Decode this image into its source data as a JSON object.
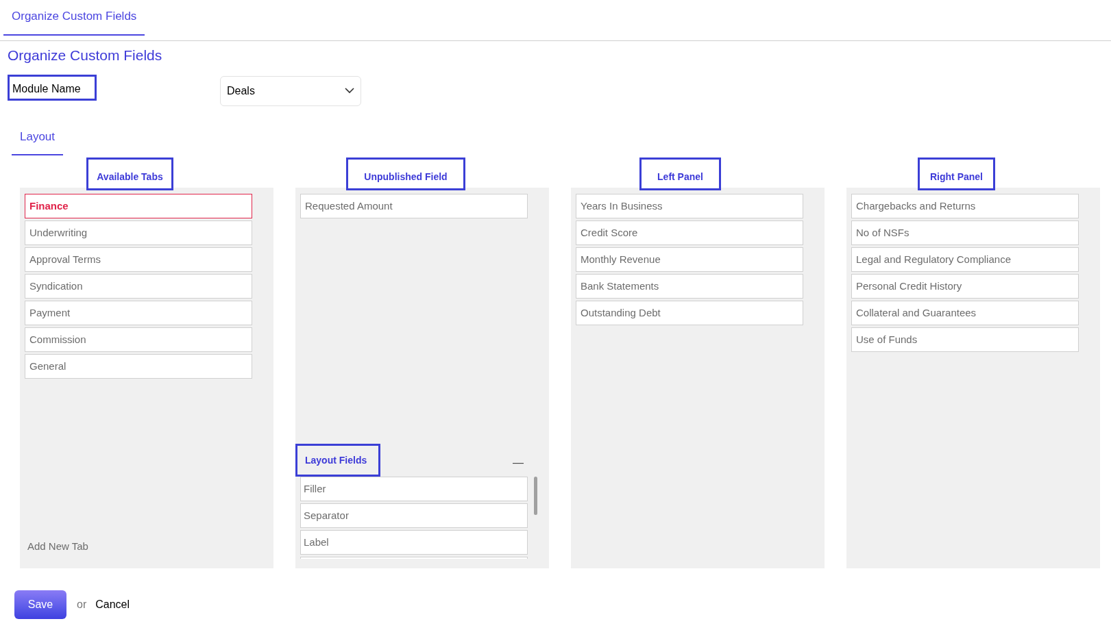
{
  "top_tabs": [
    {
      "label": "Organize Custom Fields",
      "selected": true
    }
  ],
  "title": "Organize Custom Fields",
  "module": {
    "label": "Module Name",
    "value": "Deals"
  },
  "section_tabs": [
    {
      "label": "Layout",
      "selected": true
    }
  ],
  "columns": [
    {
      "heading": "Available Tabs",
      "items": [
        {
          "label": "Finance",
          "selected": true
        },
        {
          "label": "Underwriting",
          "selected": false
        },
        {
          "label": "Approval Terms",
          "selected": false
        },
        {
          "label": "Syndication",
          "selected": false
        },
        {
          "label": "Payment",
          "selected": false
        },
        {
          "label": "Commission",
          "selected": false
        },
        {
          "label": "General",
          "selected": false
        }
      ],
      "footer_link": "Add New Tab"
    },
    {
      "heading": "Unpublished Field",
      "items": [
        {
          "label": "Requested Amount",
          "selected": false
        }
      ],
      "layout_fields": {
        "heading": "Layout Fields",
        "collapse_symbol": "—",
        "items": [
          "Filler",
          "Separator",
          "Label"
        ]
      }
    },
    {
      "heading": "Left Panel",
      "items": [
        {
          "label": "Years In Business",
          "selected": false
        },
        {
          "label": "Credit Score",
          "selected": false
        },
        {
          "label": "Monthly Revenue",
          "selected": false
        },
        {
          "label": "Bank Statements",
          "selected": false
        },
        {
          "label": "Outstanding Debt",
          "selected": false
        }
      ]
    },
    {
      "heading": "Right Panel",
      "items": [
        {
          "label": "Chargebacks and Returns",
          "selected": false
        },
        {
          "label": "No of NSFs",
          "selected": false
        },
        {
          "label": "Legal and Regulatory Compliance",
          "selected": false
        },
        {
          "label": "Personal Credit History",
          "selected": false
        },
        {
          "label": "Collateral and Guarantees",
          "selected": false
        },
        {
          "label": "Use of Funds",
          "selected": false
        }
      ]
    }
  ],
  "actions": {
    "save": "Save",
    "separator": "or",
    "cancel": "Cancel"
  }
}
